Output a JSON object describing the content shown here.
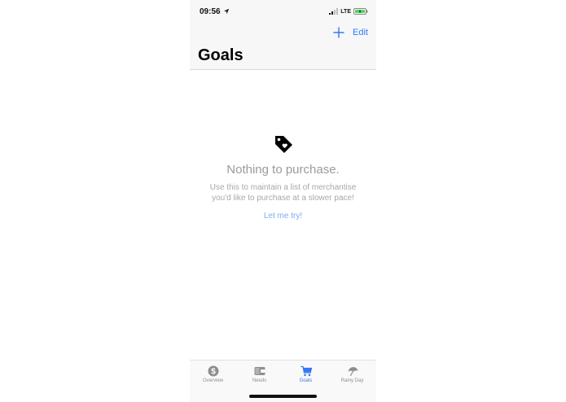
{
  "status_bar": {
    "time": "09:56",
    "network": "LTE"
  },
  "nav": {
    "edit_label": "Edit",
    "title": "Goals"
  },
  "empty_state": {
    "title": "Nothing to purchase.",
    "description": "Use this to maintain a list of merchantise you'd like to purchase at a slower pace!",
    "cta_label": "Let me try!",
    "icon": "tag-heart-icon"
  },
  "tabs": [
    {
      "label": "Overview",
      "icon": "dollar-circle-icon",
      "active": false
    },
    {
      "label": "Needs",
      "icon": "wallet-icon",
      "active": false
    },
    {
      "label": "Goals",
      "icon": "cart-icon",
      "active": true
    },
    {
      "label": "Rainy Day",
      "icon": "umbrella-icon",
      "active": false
    }
  ],
  "colors": {
    "accent": "#3478f6",
    "inactive": "#8e8e8e",
    "muted_text": "#9b9b9b",
    "link": "#78aef0"
  }
}
